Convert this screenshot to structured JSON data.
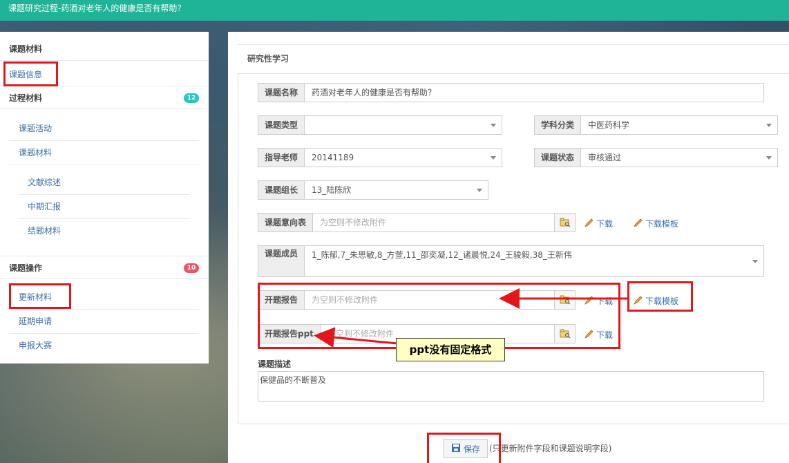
{
  "header": {
    "title": "课题研究过程-药酒对老年人的健康是否有帮助？"
  },
  "sidebar": {
    "materials_title": "课题材料",
    "topic_info": "课题信息",
    "process_title": "过程材料",
    "process_count": "12",
    "process_items": [
      "课题活动",
      "课题材料"
    ],
    "sub_items": [
      "文献综述",
      "中期汇报",
      "结题材料"
    ],
    "ops_title": "课题操作",
    "ops_count": "10",
    "ops_items": [
      "更新材料",
      "延期申请",
      "申报大赛"
    ]
  },
  "main": {
    "title": "研究性学习",
    "fields": {
      "name_label": "课题名称",
      "name_value": "药酒对老年人的健康是否有帮助？",
      "type_label": "课题类型",
      "type_value": "",
      "subject_label": "学科分类",
      "subject_value": "中医药科学",
      "teacher_label": "指导老师",
      "teacher_value": "20141189",
      "status_label": "课题状态",
      "status_value": "审核通过",
      "leader_label": "课题组长",
      "leader_value": "13_陆陈欣",
      "intent_label": "课题意向表",
      "intent_placeholder": "为空则不修改附件",
      "members_label": "课题成员",
      "members_value": "1_陈郁,7_朱思敏,8_方萱,11_邵奕凝,12_诸晨悦,24_王骏毅,38_王新伟",
      "report_label": "开题报告",
      "report_placeholder": "为空则不修改附件",
      "ppt_label": "开题报告ppt",
      "ppt_placeholder": "为空则不修改附件",
      "desc_label": "课题描述",
      "desc_value": "保健品的不断普及"
    },
    "links": {
      "download": "下载",
      "download_template": "下载模板"
    },
    "save_label": "保存",
    "save_note": "(只更新附件字段和课题说明字段)"
  },
  "annotation": {
    "callout": "ppt没有固定格式"
  },
  "colors": {
    "topbar": "#1fb397",
    "link": "#3b6ea5",
    "annotation_red": "#e3161b",
    "badge_teal": "#23c6c8",
    "badge_red": "#ed5565"
  }
}
